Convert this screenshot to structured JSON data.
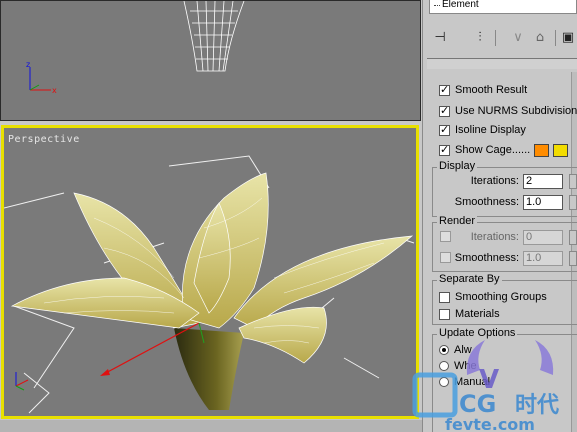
{
  "panel": {
    "modifier_list_item": "Element",
    "toolbar_icons": [
      "pin-stack-icon",
      "show-end-result-icon",
      "make-unique-icon",
      "remove-modifier-icon",
      "configure-sets-icon"
    ],
    "subdivision_surface": {
      "smooth_result": {
        "label": "Smooth Result",
        "checked": true
      },
      "use_nurms": {
        "label": "Use NURMS Subdivision",
        "checked": true
      },
      "isoline_display": {
        "label": "Isoline Display",
        "checked": true
      },
      "show_cage": {
        "label": "Show Cage......",
        "checked": true,
        "color1": "#ff8c00",
        "color2": "#f2dc00"
      }
    },
    "display": {
      "title": "Display",
      "iterations_label": "Iterations:",
      "iterations_value": "2",
      "smoothness_label": "Smoothness:",
      "smoothness_value": "1.0"
    },
    "render": {
      "title": "Render",
      "iterations_label": "Iterations:",
      "iterations_value": "0",
      "smoothness_label": "Smoothness:",
      "smoothness_value": "1.0"
    },
    "separate_by": {
      "title": "Separate By",
      "smoothing_groups": "Smoothing Groups",
      "materials": "Materials"
    },
    "update_options": {
      "title": "Update Options",
      "opt1": "Alw",
      "opt2": "Whe",
      "opt3": "Manual"
    }
  },
  "viewports": {
    "perspective_label": "Perspective"
  },
  "watermark": {
    "text1": "CG",
    "text2": "时代",
    "text3": "fevte.com"
  },
  "colors": {
    "active_viewport_border": "#e8e000",
    "viewport_bg": "#7a7a7a",
    "flower_fill": "#d8d080",
    "axis_x": "#e01010",
    "axis_y": "#10a010",
    "axis_z": "#1010e0"
  }
}
